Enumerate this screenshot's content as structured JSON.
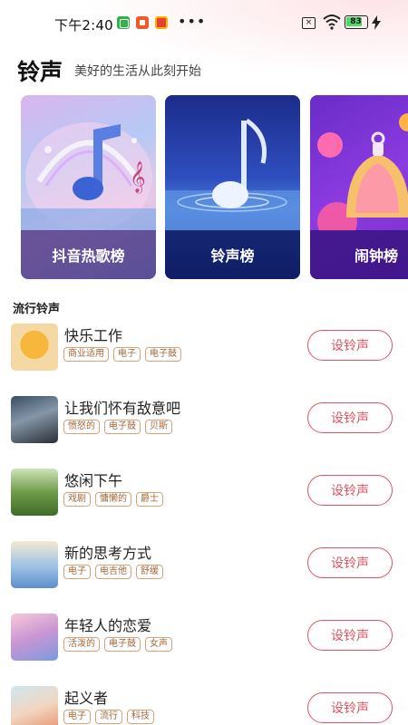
{
  "status_bar": {
    "time": "下午2:40",
    "sim_label": "×",
    "battery": "83",
    "battery_level": 0.83,
    "icons": [
      "app-icon-green",
      "app-icon-orange",
      "app-icon-red",
      "more-dots-icon",
      "sim-off-icon",
      "wifi-icon",
      "battery-icon",
      "charging-bolt-icon"
    ]
  },
  "header": {
    "title": "铃声",
    "subtitle": "美好的生活从此刻开始"
  },
  "categories": [
    {
      "label": "抖音热歌榜",
      "icon": "music-note-art"
    },
    {
      "label": "铃声榜",
      "icon": "music-note-water-art"
    },
    {
      "label": "闹钟榜",
      "icon": "bell-art"
    }
  ],
  "section": {
    "title": "流行铃声"
  },
  "button_label": "设铃声",
  "songs": [
    {
      "title": "快乐工作",
      "tags": [
        "商业适用",
        "电子",
        "电子鼓"
      ]
    },
    {
      "title": "让我们怀有敌意吧",
      "tags": [
        "愤怒的",
        "电子鼓",
        "贝斯"
      ]
    },
    {
      "title": "悠闲下午",
      "tags": [
        "戏剧",
        "慵懒的",
        "爵士"
      ]
    },
    {
      "title": "新的思考方式",
      "tags": [
        "电子",
        "电吉他",
        "舒缓"
      ]
    },
    {
      "title": "年轻人的恋爱",
      "tags": [
        "活泼的",
        "电子鼓",
        "女声"
      ]
    },
    {
      "title": "起义者",
      "tags": [
        "电子",
        "流行",
        "科技"
      ]
    }
  ],
  "colors": {
    "accent": "#e4525e",
    "tag_text": "#a5673a",
    "tag_border": "#d8a27a"
  }
}
